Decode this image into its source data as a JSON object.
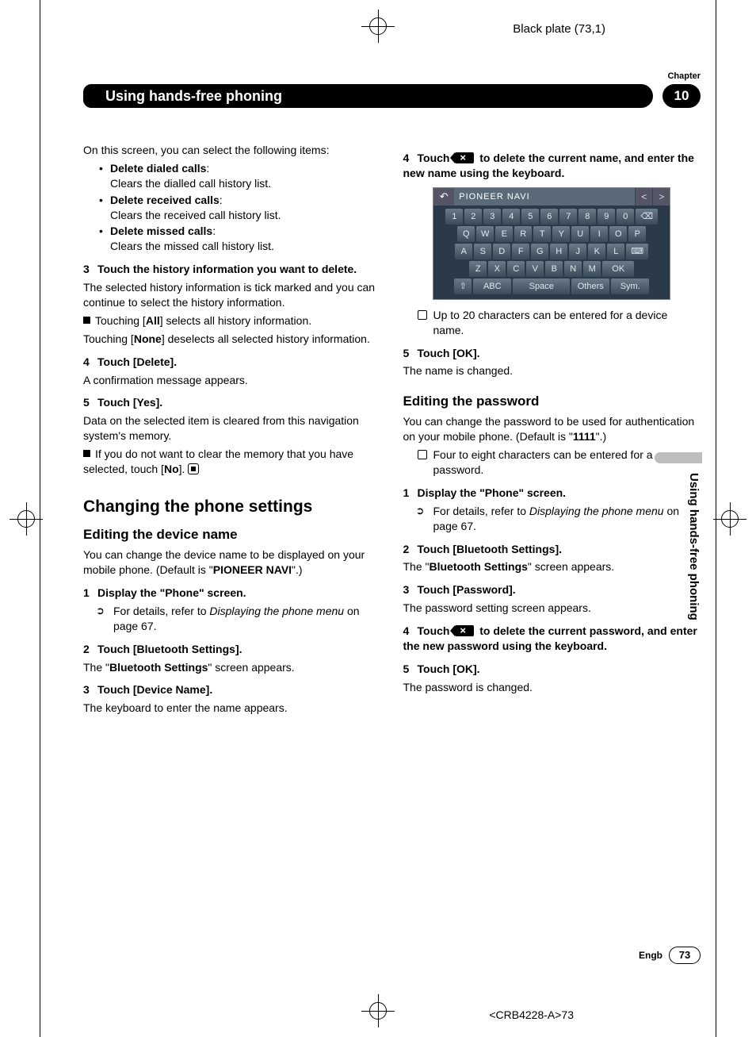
{
  "plate": "Black plate (73,1)",
  "header": {
    "chapter_label": "Chapter",
    "title": "Using hands-free phoning",
    "chapter_num": "10"
  },
  "side_tab": "Using hands-free phoning",
  "left": {
    "intro": "On this screen, you can select the following items:",
    "items": [
      {
        "title": "Delete dialed calls",
        "desc": "Clears the dialled call history list."
      },
      {
        "title": "Delete received calls",
        "desc": "Clears the received call history list."
      },
      {
        "title": "Delete missed calls",
        "desc": "Clears the missed call history list."
      }
    ],
    "step3": "Touch the history information you want to delete.",
    "step3_body": "The selected history information is tick marked and you can continue to select the history information.",
    "note_all_a": "Touching [",
    "note_all_b": "All",
    "note_all_c": "] selects all history information.",
    "note_none_a": "Touching [",
    "note_none_b": "None",
    "note_none_c": "] deselects all selected history information.",
    "step4": "Touch [Delete].",
    "step4_body": "A confirmation message appears.",
    "step5": "Touch [Yes].",
    "step5_body": "Data on the selected item is cleared from this navigation system's memory.",
    "step5_note_a": "If you do not want to clear the memory that you have selected, touch [",
    "step5_note_b": "No",
    "step5_note_c": "].",
    "h2": "Changing the phone settings",
    "h3": "Editing the device name",
    "h3_body_a": "You can change the device name to be displayed on your mobile phone. (Default is \"",
    "h3_body_b": "PIONEER NAVI",
    "h3_body_c": "\".)",
    "d_step1": "Display the \"Phone\" screen.",
    "d_step1_ref_a": "For details, refer to ",
    "d_step1_ref_b": "Displaying the phone menu",
    "d_step1_ref_c": " on page 67.",
    "d_step2": "Touch [Bluetooth Settings].",
    "d_step2_body_a": "The \"",
    "d_step2_body_b": "Bluetooth Settings",
    "d_step2_body_c": "\" screen appears.",
    "d_step3": "Touch [Device Name].",
    "d_step3_body": "The keyboard to enter the name appears."
  },
  "right": {
    "step4_a": "Touch ",
    "step4_b": " to delete the current name, and enter the new name using the keyboard.",
    "kb_title": "PIONEER NAVI",
    "kb_note": "Up to 20 characters can be entered for a device name.",
    "step5": "Touch [OK].",
    "step5_body": "The name is changed.",
    "h3": "Editing the password",
    "h3_body_a": "You can change the password to be used for authentication on your mobile phone. (Default is \"",
    "h3_body_b": "1111",
    "h3_body_c": "\".)",
    "pw_note": "Four to eight characters can be entered for a password.",
    "p_step1": "Display the \"Phone\" screen.",
    "p_step1_ref_a": "For details, refer to ",
    "p_step1_ref_b": "Displaying the phone menu",
    "p_step1_ref_c": " on page 67.",
    "p_step2": "Touch [Bluetooth Settings].",
    "p_step2_body_a": "The \"",
    "p_step2_body_b": "Bluetooth Settings",
    "p_step2_body_c": "\" screen appears.",
    "p_step3": "Touch [Password].",
    "p_step3_body": "The password setting screen appears.",
    "p_step4_a": "Touch ",
    "p_step4_b": " to delete the current password, and enter the new password using the keyboard.",
    "p_step5": "Touch [OK].",
    "p_step5_body": "The password is changed."
  },
  "kb": {
    "row1": [
      "1",
      "2",
      "3",
      "4",
      "5",
      "6",
      "7",
      "8",
      "9",
      "0"
    ],
    "row2": [
      "Q",
      "W",
      "E",
      "R",
      "T",
      "Y",
      "U",
      "I",
      "O",
      "P"
    ],
    "row3": [
      "A",
      "S",
      "D",
      "F",
      "G",
      "H",
      "J",
      "K",
      "L"
    ],
    "row4": [
      "Z",
      "X",
      "C",
      "V",
      "B",
      "N",
      "M"
    ],
    "bottom": {
      "shift": "⇧",
      "abc": "ABC",
      "space": "Space",
      "others": "Others",
      "sym": "Sym.",
      "ok": "OK",
      "alt": "⌨"
    }
  },
  "footer": {
    "lang": "Engb",
    "page": "73",
    "docref": "<CRB4228-A>73"
  }
}
